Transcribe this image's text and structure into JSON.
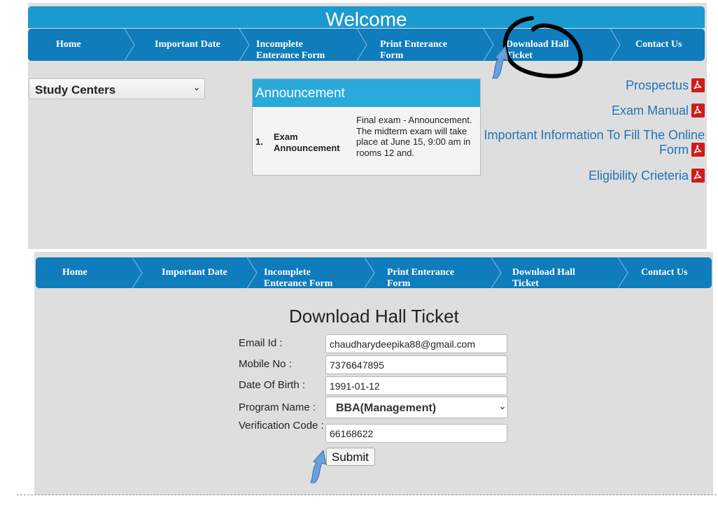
{
  "header": {
    "welcome": "Welcome"
  },
  "nav": [
    {
      "label": "Home"
    },
    {
      "label": "Important Date"
    },
    {
      "label": "Incomplete Enterance Form"
    },
    {
      "label": "Print Enterance Form"
    },
    {
      "label": "Download Hall Ticket"
    },
    {
      "label": "Contact Us"
    }
  ],
  "study_centers": {
    "label": "Study Centers"
  },
  "announcement": {
    "heading": "Announcement",
    "items": [
      {
        "number": "1.",
        "title": "Exam Announcement",
        "text": "Final exam - Announcement. The midterm exam will take place at June 15, 9:00 am in rooms 12 and."
      }
    ]
  },
  "documents": [
    {
      "label": "Prospectus"
    },
    {
      "label": "Exam Manual"
    },
    {
      "label": "Important Information To Fill The Online Form"
    },
    {
      "label": "Eligibility Crieteria"
    }
  ],
  "form": {
    "title": "Download Hall Ticket",
    "email_label": "Email Id :",
    "email_value": "chaudharydeepika88@gmail.com",
    "mobile_label": "Mobile No :",
    "mobile_value": "7376647895",
    "dob_label": "Date Of Birth :",
    "dob_value": "1991-01-12",
    "program_label": "Program Name :",
    "program_value": "BBA(Management)",
    "verification_label": "Verification Code :",
    "verification_value": "66168622",
    "submit_label": "Submit"
  },
  "colors": {
    "nav": "#0f7cbb",
    "header": "#1b9ad0",
    "link": "#1f73b7",
    "pdf": "#cc1d1d"
  }
}
